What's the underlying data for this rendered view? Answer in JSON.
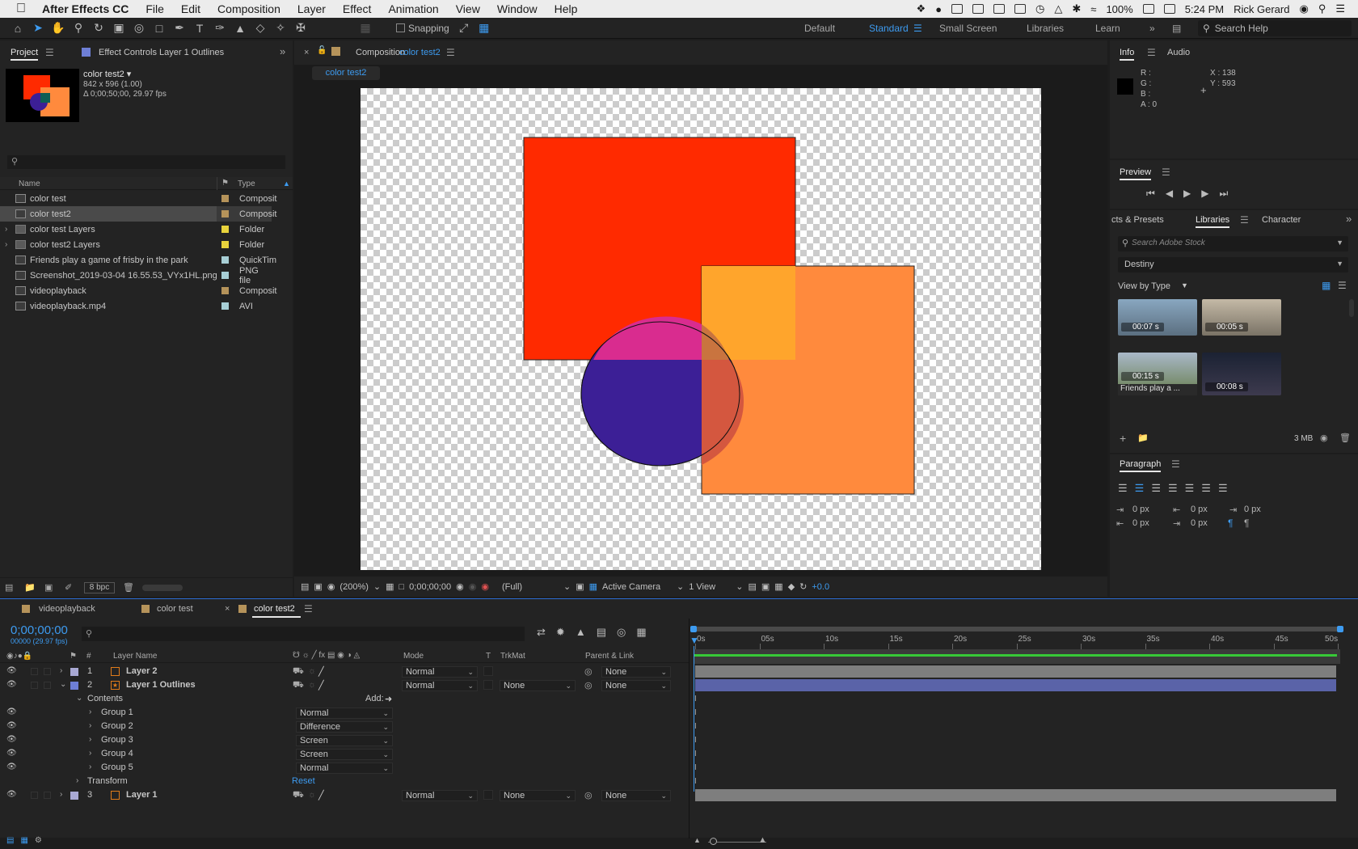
{
  "menubar": {
    "app": "After Effects CC",
    "items": [
      "File",
      "Edit",
      "Composition",
      "Layer",
      "Effect",
      "Animation",
      "View",
      "Window",
      "Help"
    ],
    "battery": "100%",
    "time": "5:24 PM",
    "user": "Rick Gerard"
  },
  "toolbar": {
    "snapping": "Snapping",
    "workspaces": [
      "Default",
      "Standard",
      "Small Screen",
      "Libraries",
      "Learn"
    ],
    "active_workspace": "Standard",
    "search_placeholder": "Search Help"
  },
  "project": {
    "tab": "Project",
    "effect_tab": "Effect Controls Layer 1 Outlines",
    "item_name": "color test2 ▾",
    "item_size": "842 x 596 (1.00)",
    "item_duration": "Δ 0;00;50;00, 29.97 fps",
    "col_name": "Name",
    "col_type": "Type",
    "items": [
      {
        "name": "color test",
        "type": "Composit",
        "color": "#b5935a",
        "kind": "comp",
        "selected": false
      },
      {
        "name": "color test2",
        "type": "Composit",
        "color": "#b5935a",
        "kind": "comp",
        "selected": true
      },
      {
        "name": "color test Layers",
        "type": "Folder",
        "color": "#e8d33c",
        "kind": "folder",
        "selected": false
      },
      {
        "name": "color test2 Layers",
        "type": "Folder",
        "color": "#e8d33c",
        "kind": "folder",
        "selected": false
      },
      {
        "name": "Friends play a game of frisby in the park",
        "type": "QuickTim",
        "color": "#a8cfd6",
        "kind": "footage",
        "selected": false
      },
      {
        "name": "Screenshot_2019-03-04 16.55.53_VYx1HL.png",
        "type": "PNG file",
        "color": "#a8cfd6",
        "kind": "footage",
        "selected": false
      },
      {
        "name": "videoplayback",
        "type": "Composit",
        "color": "#b5935a",
        "kind": "comp",
        "selected": false
      },
      {
        "name": "videoplayback.mp4",
        "type": "AVI",
        "color": "#a8cfd6",
        "kind": "footage",
        "selected": false
      }
    ],
    "bpc": "8 bpc"
  },
  "comp": {
    "tab_prefix": "Composition",
    "tab_name": "color test2",
    "subtab": "color test2",
    "zoom": "(200%)",
    "timecode": "0;00;00;00",
    "resolution": "(Full)",
    "camera": "Active Camera",
    "views": "1 View",
    "exposure": "+0.0"
  },
  "info": {
    "tab": "Info",
    "audio_tab": "Audio",
    "r": "R :",
    "g": "G :",
    "b": "B :",
    "a": "A :  0",
    "x": "X : 138",
    "y": "Y : 593"
  },
  "preview": {
    "tab": "Preview"
  },
  "libraries": {
    "tab_effects": "cts & Presets",
    "tab_libraries": "Libraries",
    "tab_character": "Character",
    "search_placeholder": "Search Adobe Stock",
    "library": "Destiny",
    "view_by": "View by Type",
    "thumbs": [
      "00:07 s",
      "00:05 s",
      "00:15 s",
      "00:08 s"
    ],
    "thumb_caption": "Friends play a ...",
    "storage": "3 MB"
  },
  "paragraph": {
    "tab": "Paragraph",
    "values": [
      "0 px",
      "0 px",
      "0 px",
      "0 px",
      "0 px"
    ]
  },
  "timeline": {
    "tabs": [
      "videoplayback",
      "color test",
      "color test2"
    ],
    "active_tab": "color test2",
    "timecode": "0;00;00;00",
    "frame": "00000 (29.97 fps)",
    "col_num": "#",
    "col_layer_name": "Layer Name",
    "col_mode": "Mode",
    "col_t": "T",
    "col_trkmat": "TrkMat",
    "col_parent": "Parent & Link",
    "ruler": [
      "0s",
      "05s",
      "10s",
      "15s",
      "20s",
      "25s",
      "30s",
      "35s",
      "40s",
      "45s",
      "50s"
    ],
    "layers": [
      {
        "num": "1",
        "name": "Layer 2",
        "mode": "Normal",
        "trkmat": "",
        "parent": "None",
        "color": "#a9a9d4"
      },
      {
        "num": "2",
        "name": "Layer 1 Outlines",
        "mode": "Normal",
        "trkmat": "None",
        "parent": "None",
        "color": "#6e7fd6"
      }
    ],
    "contents": "Contents",
    "add": "Add:",
    "groups": [
      {
        "name": "Group 1",
        "mode": "Normal"
      },
      {
        "name": "Group 2",
        "mode": "Difference"
      },
      {
        "name": "Group 3",
        "mode": "Screen"
      },
      {
        "name": "Group 4",
        "mode": "Screen"
      },
      {
        "name": "Group 5",
        "mode": "Normal"
      }
    ],
    "transform": "Transform",
    "reset": "Reset",
    "layer3": {
      "num": "3",
      "name": "Layer 1",
      "mode": "Normal",
      "trkmat": "None",
      "parent": "None",
      "color": "#a9a9d4"
    }
  },
  "colors": {
    "accent": "#3d9bf0",
    "red_rect": "#ff2a00",
    "orange_rect": "#ff8a3d",
    "circle": "#3c1f96"
  }
}
